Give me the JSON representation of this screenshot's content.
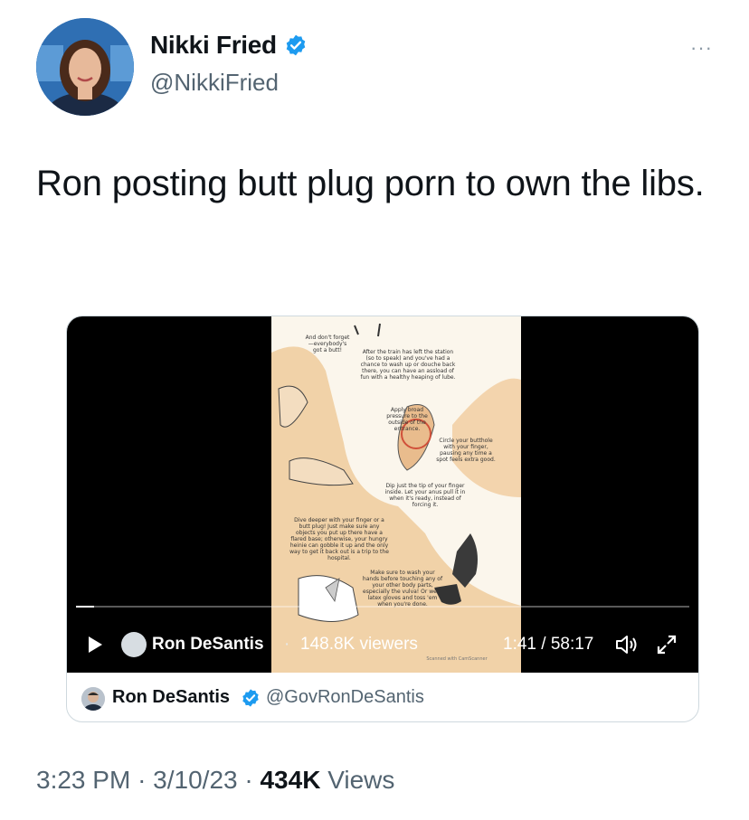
{
  "author": {
    "display_name": "Nikki Fried",
    "handle": "@NikkiFried"
  },
  "tweet": {
    "text": "Ron posting butt plug porn to own the libs."
  },
  "more_label": "···",
  "video": {
    "host_name": "Ron DeSantis",
    "separator": "·",
    "viewers": "148.8K viewers",
    "time": "1:41 / 58:17",
    "progress": 0.03,
    "comic_texts": [
      "And don't forget—everybody's got a butt!",
      "After the train has left the station (so to speak) and you've had a chance to wash up or douche back there, you can have an assload of fun with a healthy heaping of lube.",
      "Apply broad pressure to the outside of the entrance.",
      "Circle your butthole with your finger, pausing any time a spot feels extra good.",
      "Dip just the tip of your finger inside. Let your anus pull it in when it's ready, instead of forcing it.",
      "Dive deeper with your finger or a butt plug! Just make sure any objects you put up there have a flared base; otherwise, your hungry heinie can gobble it up and the only way to get it back out is a trip to the hospital.",
      "Make sure to wash your hands before touching any of your other body parts, especially the vulva! Or wear latex gloves and toss 'em when you're done.",
      "Scanned with CamScanner"
    ]
  },
  "quoted": {
    "display_name": "Ron DeSantis",
    "handle": "@GovRonDeSantis"
  },
  "meta": {
    "time": "3:23 PM",
    "dot1": "·",
    "date": "3/10/23",
    "dot2": "·",
    "views_count": "434K",
    "views_label": "Views"
  },
  "colors": {
    "verified": "#1d9bf0",
    "secondary_text": "#536471",
    "primary_text": "#0f1419"
  }
}
